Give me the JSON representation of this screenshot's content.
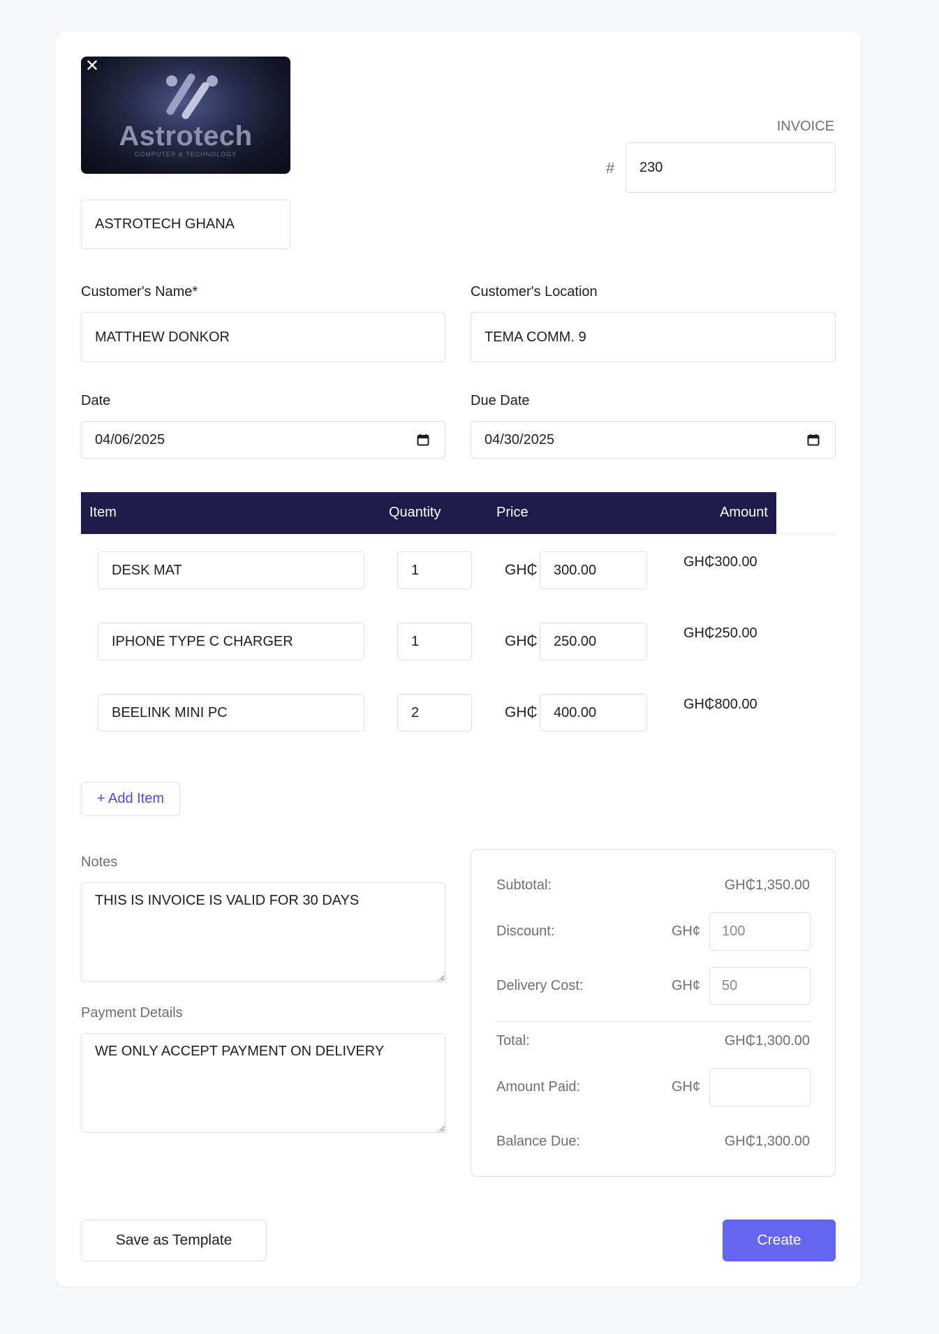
{
  "company": {
    "logo_name": "Astrotech",
    "logo_tagline": "COMPUTER & TECHNOLOGY",
    "name_value": "ASTROTECH GHANA"
  },
  "invoice": {
    "label": "INVOICE",
    "hash": "#",
    "number": "230"
  },
  "customer": {
    "name_label": "Customer's Name*",
    "name_value": "MATTHEW DONKOR",
    "location_label": "Customer's Location",
    "location_value": "TEMA COMM. 9"
  },
  "dates": {
    "date_label": "Date",
    "date_value": "04/06/2025",
    "due_label": "Due Date",
    "due_value": "04/30/2025"
  },
  "table": {
    "headers": {
      "item": "Item",
      "quantity": "Quantity",
      "price": "Price",
      "amount": "Amount"
    },
    "currency": "GH₵",
    "rows": [
      {
        "item": "DESK MAT",
        "qty": "1",
        "price": "300.00",
        "amount": "GH₵300.00"
      },
      {
        "item": "IPHONE TYPE C CHARGER",
        "qty": "1",
        "price": "250.00",
        "amount": "GH₵250.00"
      },
      {
        "item": "BEELINK MINI PC",
        "qty": "2",
        "price": "400.00",
        "amount": "GH₵800.00"
      }
    ],
    "add_item_label": "+ Add Item"
  },
  "notes": {
    "label": "Notes",
    "value": "THIS IS INVOICE IS VALID FOR 30 DAYS",
    "payment_label": "Payment Details",
    "payment_value": "WE ONLY ACCEPT PAYMENT ON DELIVERY"
  },
  "summary": {
    "subtotal_label": "Subtotal:",
    "subtotal_value": "GH₵1,350.00",
    "discount_label": "Discount:",
    "discount_currency": "GH¢",
    "discount_value": "100",
    "delivery_label": "Delivery Cost:",
    "delivery_currency": "GH¢",
    "delivery_value": "50",
    "total_label": "Total:",
    "total_value": "GH₵1,300.00",
    "paid_label": "Amount Paid:",
    "paid_currency": "GH¢",
    "paid_value": "",
    "balance_label": "Balance Due:",
    "balance_value": "GH₵1,300.00"
  },
  "actions": {
    "template_label": "Save as Template",
    "create_label": "Create"
  },
  "colors": {
    "table_header_bg": "#1e1b4b",
    "accent": "#6366f1",
    "link": "#4f46e5"
  }
}
